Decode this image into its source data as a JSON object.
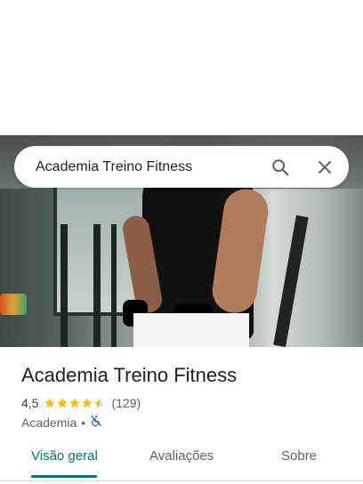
{
  "search": {
    "query": "Academia Treino Fitness"
  },
  "place": {
    "name": "Academia Treino Fitness",
    "rating": "4,5",
    "rating_value": 4.5,
    "review_count": "(129)",
    "category": "Academia",
    "separator": "•"
  },
  "tabs": [
    {
      "label": "Visão geral",
      "active": true
    },
    {
      "label": "Avaliações",
      "active": false
    },
    {
      "label": "Sobre",
      "active": false
    }
  ],
  "colors": {
    "accent": "#00796b",
    "star": "#fbbc04",
    "accessibility_icon": "#1a73e8"
  }
}
